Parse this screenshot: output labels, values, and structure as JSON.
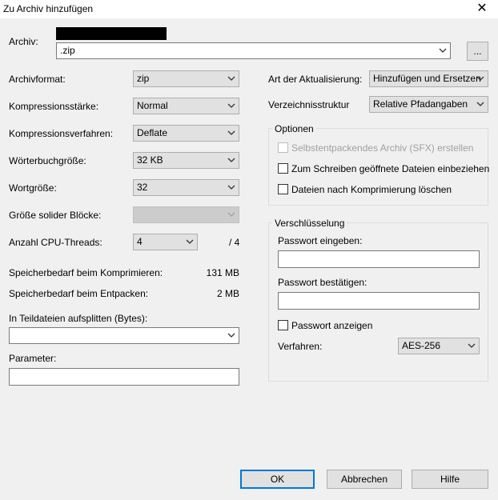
{
  "window": {
    "title": "Zu Archiv hinzufügen",
    "close": "✕"
  },
  "archive": {
    "label": "Archiv:",
    "path": ".zip",
    "browse": "..."
  },
  "left": {
    "format_label": "Archivformat:",
    "format_value": "zip",
    "level_label": "Kompressionsstärke:",
    "level_value": "Normal",
    "method_label": "Kompressionsverfahren:",
    "method_value": "Deflate",
    "dict_label": "Wörterbuchgröße:",
    "dict_value": "32 KB",
    "word_label": "Wortgröße:",
    "word_value": "32",
    "solid_label": "Größe solider Blöcke:",
    "solid_value": "",
    "threads_label": "Anzahl CPU-Threads:",
    "threads_value": "4",
    "threads_total": "/ 4",
    "mem_compress_label": "Speicherbedarf beim Komprimieren:",
    "mem_compress_value": "131 MB",
    "mem_decompress_label": "Speicherbedarf beim Entpacken:",
    "mem_decompress_value": "2 MB",
    "split_label": "In Teildateien aufsplitten (Bytes):",
    "split_value": "",
    "params_label": "Parameter:",
    "params_value": ""
  },
  "right": {
    "update_label": "Art der Aktualisierung:",
    "update_value": "Hinzufügen und Ersetzen",
    "paths_label": "Verzeichnisstruktur",
    "paths_value": "Relative Pfadangaben",
    "options": {
      "title": "Optionen",
      "sfx": "Selbstentpackendes Archiv (SFX) erstellen",
      "shared": "Zum Schreiben geöffnete Dateien einbeziehen",
      "delete": "Dateien nach Komprimierung löschen"
    },
    "encryption": {
      "title": "Verschlüsselung",
      "pw_label": "Passwort eingeben:",
      "pw_confirm_label": "Passwort bestätigen:",
      "show_pw": "Passwort anzeigen",
      "method_label": "Verfahren:",
      "method_value": "AES-256"
    }
  },
  "buttons": {
    "ok": "OK",
    "cancel": "Abbrechen",
    "help": "Hilfe"
  },
  "colors": {
    "default_button_border": "#0078d7",
    "dialog_bg": "#f0f0f0"
  }
}
